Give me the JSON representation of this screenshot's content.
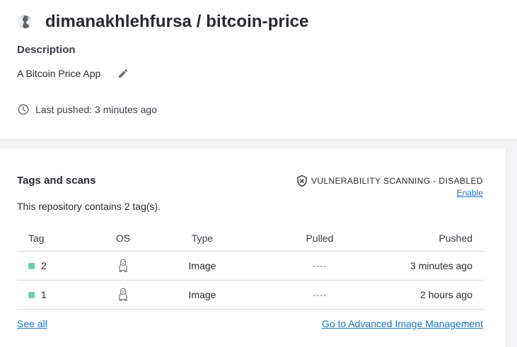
{
  "repository": {
    "title": "dimanakhlehfursa / bitcoin-price",
    "visibility_icon": "globe-icon"
  },
  "description": {
    "heading": "Description",
    "text": "A Bitcoin Price App",
    "edit_icon": "pencil-icon"
  },
  "last_pushed": {
    "text": "Last pushed: 3 minutes ago",
    "icon": "clock-icon"
  },
  "tags_section": {
    "title": "Tags and scans",
    "scan_status": "VULNERABILITY SCANNING - DISABLED",
    "scan_icon": "shield-x-icon",
    "enable_label": "Enable",
    "subtitle": "This repository contains 2 tag(s).",
    "columns": [
      "Tag",
      "OS",
      "Type",
      "Pulled",
      "Pushed"
    ],
    "rows": [
      {
        "tag": "2",
        "os": "linux",
        "type": "Image",
        "pulled": "----",
        "pushed": "3 minutes ago",
        "dot_color": "#6fcfa4"
      },
      {
        "tag": "1",
        "os": "linux",
        "type": "Image",
        "pulled": "----",
        "pushed": "2 hours ago",
        "dot_color": "#6fcfa4"
      }
    ],
    "see_all_label": "See all",
    "advanced_label": "Go to Advanced Image Management"
  },
  "colors": {
    "link": "#1a73c9",
    "tag_dot": "#6fcfa4",
    "text": "#27292e",
    "backdrop": "#f4f4f6"
  }
}
